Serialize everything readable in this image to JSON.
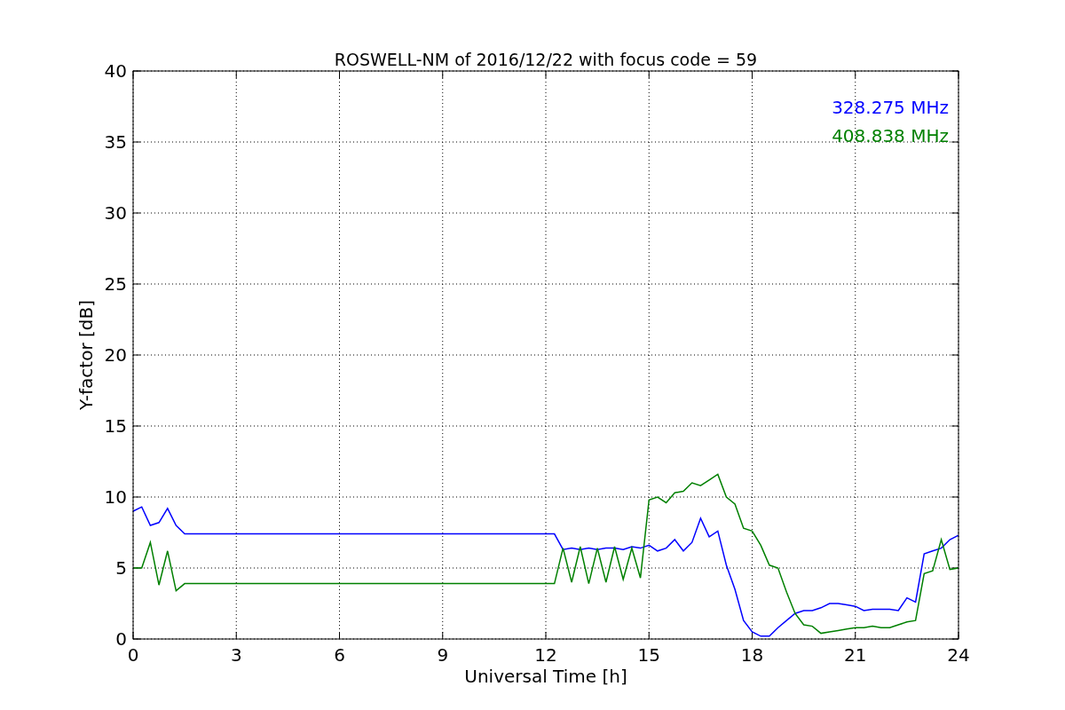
{
  "chart_data": {
    "type": "line",
    "title": "ROSWELL-NM of 2016/12/22 with focus code = 59",
    "xlabel": "Universal Time [h]",
    "ylabel": "Y-factor [dB]",
    "x": [
      0,
      0.25,
      0.5,
      0.75,
      1,
      1.25,
      1.5,
      1.75,
      2,
      2.25,
      2.5,
      2.75,
      3,
      3.25,
      3.5,
      3.75,
      4,
      4.25,
      4.5,
      4.75,
      5,
      5.25,
      5.5,
      5.75,
      6,
      6.25,
      6.5,
      6.75,
      7,
      7.25,
      7.5,
      7.75,
      8,
      8.25,
      8.5,
      8.75,
      9,
      9.25,
      9.5,
      9.75,
      10,
      10.25,
      10.5,
      10.75,
      11,
      11.25,
      11.5,
      11.75,
      12,
      12.25,
      12.5,
      12.75,
      13,
      13.25,
      13.5,
      13.75,
      14,
      14.25,
      14.5,
      14.75,
      15,
      15.25,
      15.5,
      15.75,
      16,
      16.25,
      16.5,
      16.75,
      17,
      17.25,
      17.5,
      17.75,
      18,
      18.25,
      18.5,
      18.75,
      19,
      19.25,
      19.5,
      19.75,
      20,
      20.25,
      20.5,
      20.75,
      21,
      21.25,
      21.5,
      21.75,
      22,
      22.25,
      22.5,
      22.75,
      23,
      23.25,
      23.5,
      23.75,
      24
    ],
    "series": [
      {
        "name": "328.275 MHz",
        "color": "#0000ff",
        "values": [
          9.0,
          9.3,
          8.0,
          8.2,
          9.2,
          8.0,
          7.4,
          7.4,
          7.4,
          7.4,
          7.4,
          7.4,
          7.4,
          7.4,
          7.4,
          7.4,
          7.4,
          7.4,
          7.4,
          7.4,
          7.4,
          7.4,
          7.4,
          7.4,
          7.4,
          7.4,
          7.4,
          7.4,
          7.4,
          7.4,
          7.4,
          7.4,
          7.4,
          7.4,
          7.4,
          7.4,
          7.4,
          7.4,
          7.4,
          7.4,
          7.4,
          7.4,
          7.4,
          7.4,
          7.4,
          7.4,
          7.4,
          7.4,
          7.4,
          7.4,
          6.3,
          6.4,
          6.3,
          6.4,
          6.3,
          6.4,
          6.4,
          6.3,
          6.5,
          6.4,
          6.6,
          6.2,
          6.4,
          7.0,
          6.2,
          6.8,
          8.5,
          7.2,
          7.6,
          5.2,
          3.5,
          1.3,
          0.5,
          0.2,
          0.2,
          0.8,
          1.3,
          1.8,
          2.0,
          2.0,
          2.2,
          2.5,
          2.5,
          2.4,
          2.3,
          2.0,
          2.1,
          2.1,
          2.1,
          2.0,
          2.9,
          2.6,
          6.0,
          6.2,
          6.4,
          7.0,
          7.3
        ]
      },
      {
        "name": "408.838 MHz",
        "color": "#008000",
        "values": [
          5.0,
          5.0,
          6.8,
          3.8,
          6.2,
          3.4,
          3.9,
          3.9,
          3.9,
          3.9,
          3.9,
          3.9,
          3.9,
          3.9,
          3.9,
          3.9,
          3.9,
          3.9,
          3.9,
          3.9,
          3.9,
          3.9,
          3.9,
          3.9,
          3.9,
          3.9,
          3.9,
          3.9,
          3.9,
          3.9,
          3.9,
          3.9,
          3.9,
          3.9,
          3.9,
          3.9,
          3.9,
          3.9,
          3.9,
          3.9,
          3.9,
          3.9,
          3.9,
          3.9,
          3.9,
          3.9,
          3.9,
          3.9,
          3.9,
          3.9,
          6.4,
          4.0,
          6.5,
          3.9,
          6.4,
          4.0,
          6.5,
          4.2,
          6.4,
          4.3,
          9.8,
          10.0,
          9.6,
          10.3,
          10.4,
          11.0,
          10.8,
          11.2,
          11.6,
          10.0,
          9.5,
          7.8,
          7.6,
          6.6,
          5.2,
          5.0,
          3.3,
          1.8,
          1.0,
          0.9,
          0.4,
          0.5,
          0.6,
          0.7,
          0.8,
          0.8,
          0.9,
          0.8,
          0.8,
          1.0,
          1.2,
          1.3,
          4.6,
          4.8,
          7.0,
          4.9,
          5.0
        ]
      }
    ],
    "grid": true,
    "xlim": [
      0,
      24
    ],
    "ylim": [
      0,
      40
    ],
    "xticks": [
      0,
      3,
      6,
      9,
      12,
      15,
      18,
      21,
      24
    ],
    "yticks": [
      0,
      5,
      10,
      15,
      20,
      25,
      30,
      35,
      40
    ]
  }
}
